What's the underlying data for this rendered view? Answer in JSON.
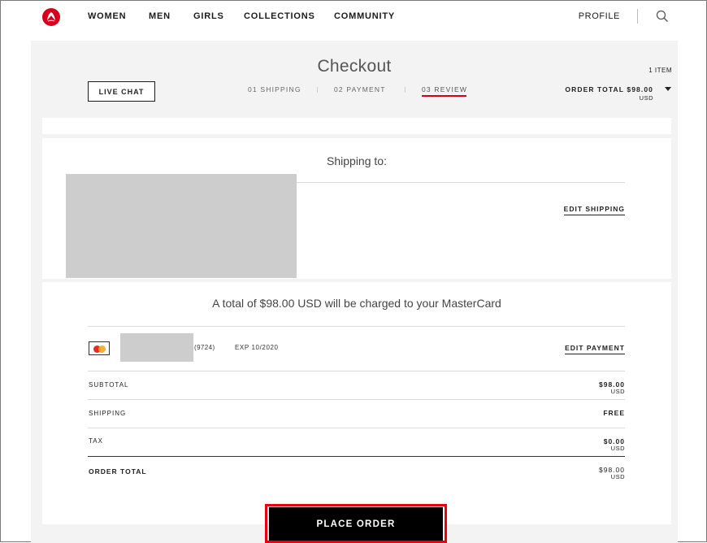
{
  "nav": {
    "brand_color": "#d6001c",
    "links": [
      "WOMEN",
      "MEN",
      "GIRLS",
      "COLLECTIONS",
      "COMMUNITY"
    ],
    "profile": "PROFILE",
    "search_icon": "search-icon"
  },
  "checkout": {
    "title": "Checkout",
    "live_chat": "LIVE CHAT",
    "steps": [
      "01 SHIPPING",
      "02 PAYMENT",
      "03 REVIEW"
    ],
    "active_step": "03 REVIEW",
    "item_count": "1 ITEM",
    "order_total_label": "ORDER TOTAL $98.00",
    "order_total_currency": "USD"
  },
  "shipping": {
    "heading": "Shipping to:",
    "edit_label": "EDIT SHIPPING"
  },
  "payment": {
    "heading": "A total of $98.00 USD will be charged to your MasterCard",
    "card_icon": "mastercard-icon",
    "card_last4": "(9724)",
    "card_exp": "EXP 10/2020",
    "edit_label": "EDIT PAYMENT"
  },
  "summary": {
    "subtotal_label": "SUBTOTAL",
    "subtotal_value": "$98.00",
    "subtotal_currency": "USD",
    "shipping_label": "SHIPPING",
    "shipping_value": "FREE",
    "tax_label": "TAX",
    "tax_value": "$0.00",
    "tax_currency": "USD",
    "total_label": "ORDER TOTAL",
    "total_value": "$98.00",
    "total_currency": "USD"
  },
  "place_order": {
    "label": "PLACE ORDER",
    "highlight_color": "#e8000f"
  }
}
